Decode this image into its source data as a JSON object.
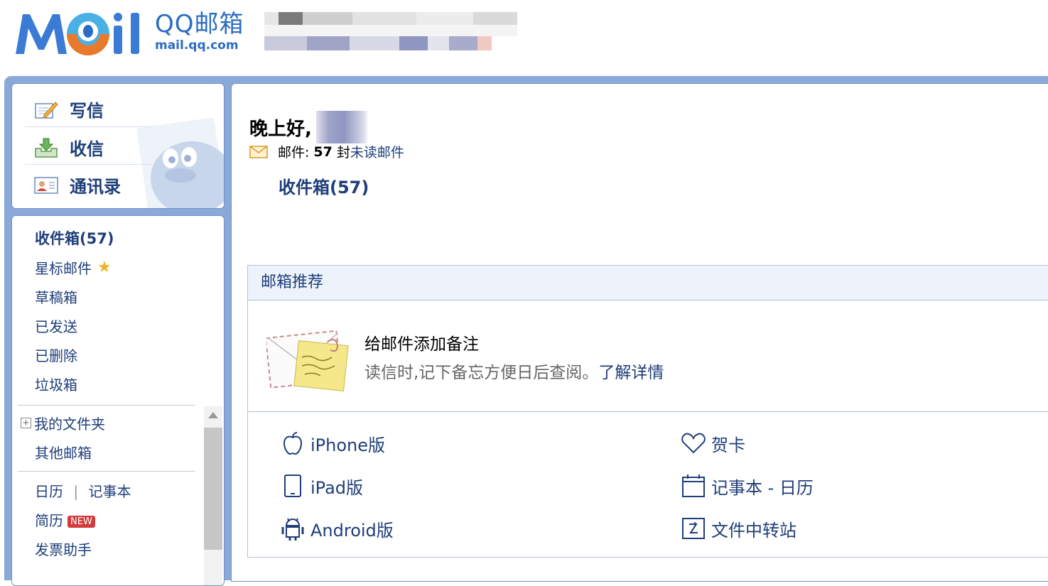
{
  "header": {
    "logo_word": "MOil",
    "brand_cn": "QQ邮箱",
    "brand_url": "mail.qq.com"
  },
  "actions": [
    {
      "label": "写信",
      "icon": "compose-icon"
    },
    {
      "label": "收信",
      "icon": "receive-icon"
    },
    {
      "label": "通讯录",
      "icon": "contacts-icon"
    }
  ],
  "folders": {
    "inbox": "收件箱(57)",
    "starred": "星标邮件",
    "drafts": "草稿箱",
    "sent": "已发送",
    "deleted": "已删除",
    "spam": "垃圾箱",
    "my_folders": "我的文件夹",
    "other_mailboxes": "其他邮箱",
    "calendar": "日历",
    "divider": "|",
    "notebook": "记事本",
    "resume": "简历",
    "resume_badge": "NEW",
    "invoice": "发票助手"
  },
  "main": {
    "greeting": "晚上好,",
    "mail_prefix": "邮件:",
    "unread_count": "57",
    "unread_unit": "封",
    "unread_link": "未读邮件",
    "inbox_link": "收件箱(57)",
    "recommend": {
      "title": "邮箱推荐",
      "feature_title": "给邮件添加备注",
      "feature_desc": "读信时,记下备忘方便日后查阅。",
      "feature_link": "了解详情",
      "links": [
        {
          "label": "iPhone版",
          "icon": "apple-icon"
        },
        {
          "label": "贺卡",
          "icon": "heart-icon"
        },
        {
          "label": "iPad版",
          "icon": "tablet-icon"
        },
        {
          "label": "记事本 - 日历",
          "icon": "calendar-icon"
        },
        {
          "label": "Android版",
          "icon": "android-icon"
        },
        {
          "label": "文件中转站",
          "icon": "transfer-icon"
        }
      ]
    }
  },
  "colors": {
    "brand_blue": "#2b6cc4",
    "link_blue": "#1f3e7a",
    "frame_blue": "#8aa9d9",
    "badge_red": "#d23b3b"
  }
}
